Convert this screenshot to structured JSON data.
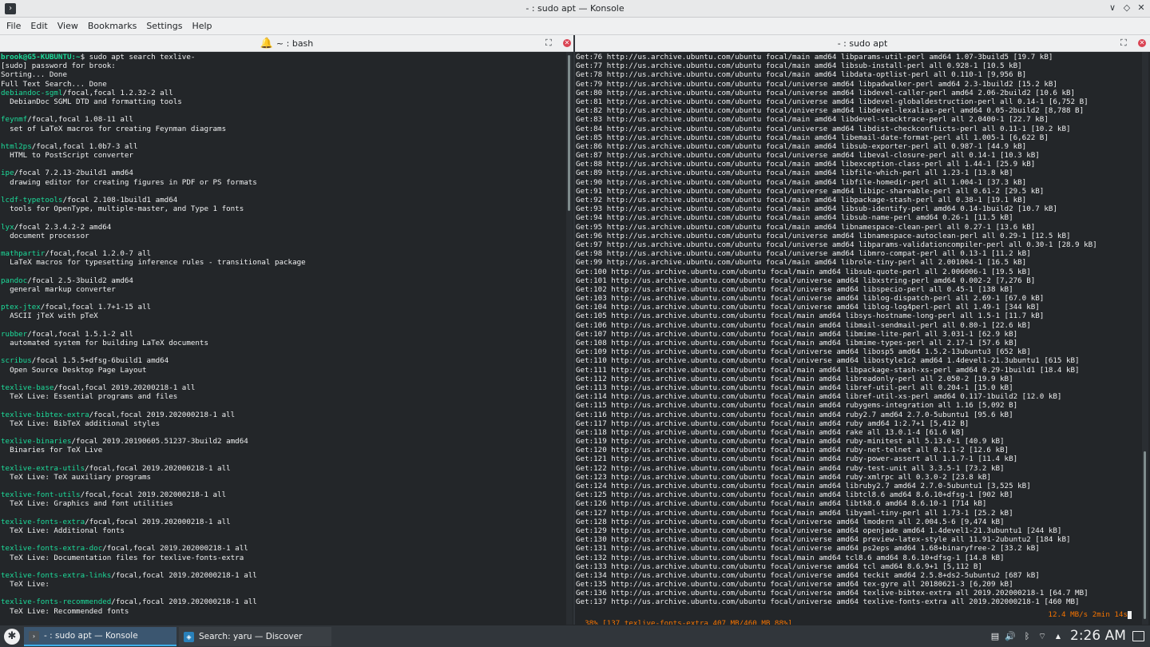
{
  "window": {
    "title": "- : sudo apt — Konsole",
    "app_icon_glyph": "›",
    "controls": [
      "∨",
      "◇",
      "✕"
    ]
  },
  "menu": [
    "File",
    "Edit",
    "View",
    "Bookmarks",
    "Settings",
    "Help"
  ],
  "panes": {
    "left": {
      "title": "~ : bash",
      "bell_icon": "bell-icon"
    },
    "right": {
      "title": "- : sudo apt"
    }
  },
  "left_terminal": [
    [
      {
        "t": "brook@G5-KUBUNTU:~",
        "c": "prompt-user"
      },
      {
        "t": "$ sudo apt search texlive-"
      }
    ],
    [
      {
        "t": "[sudo] password for brook:"
      }
    ],
    [
      {
        "t": "Sorting... Done"
      }
    ],
    [
      {
        "t": "Full Text Search... Done"
      }
    ],
    [
      {
        "t": "debiandoc-sgml",
        "c": "green"
      },
      {
        "t": "/focal,focal 1.2.32-2 all"
      }
    ],
    [
      {
        "t": "  DebianDoc SGML DTD and formatting tools"
      }
    ],
    [
      {
        "t": ""
      }
    ],
    [
      {
        "t": "feynmf",
        "c": "green"
      },
      {
        "t": "/focal,focal 1.08-11 all"
      }
    ],
    [
      {
        "t": "  set of LaTeX macros for creating Feynman diagrams"
      }
    ],
    [
      {
        "t": ""
      }
    ],
    [
      {
        "t": "html2ps",
        "c": "green"
      },
      {
        "t": "/focal,focal 1.0b7-3 all"
      }
    ],
    [
      {
        "t": "  HTML to PostScript converter"
      }
    ],
    [
      {
        "t": ""
      }
    ],
    [
      {
        "t": "ipe",
        "c": "green"
      },
      {
        "t": "/focal 7.2.13-2build1 amd64"
      }
    ],
    [
      {
        "t": "  drawing editor for creating figures in PDF or PS formats"
      }
    ],
    [
      {
        "t": ""
      }
    ],
    [
      {
        "t": "lcdf-typetools",
        "c": "green"
      },
      {
        "t": "/focal 2.108-1build1 amd64"
      }
    ],
    [
      {
        "t": "  tools for OpenType, multiple-master, and Type 1 fonts"
      }
    ],
    [
      {
        "t": ""
      }
    ],
    [
      {
        "t": "lyx",
        "c": "green"
      },
      {
        "t": "/focal 2.3.4.2-2 amd64"
      }
    ],
    [
      {
        "t": "  document processor"
      }
    ],
    [
      {
        "t": ""
      }
    ],
    [
      {
        "t": "mathpartir",
        "c": "green"
      },
      {
        "t": "/focal,focal 1.2.0-7 all"
      }
    ],
    [
      {
        "t": "  LaTeX macros for typesetting inference rules - transitional package"
      }
    ],
    [
      {
        "t": ""
      }
    ],
    [
      {
        "t": "pandoc",
        "c": "green"
      },
      {
        "t": "/focal 2.5-3build2 amd64"
      }
    ],
    [
      {
        "t": "  general markup converter"
      }
    ],
    [
      {
        "t": ""
      }
    ],
    [
      {
        "t": "ptex-jtex",
        "c": "green"
      },
      {
        "t": "/focal,focal 1.7+1-15 all"
      }
    ],
    [
      {
        "t": "  ASCII jTeX with pTeX"
      }
    ],
    [
      {
        "t": ""
      }
    ],
    [
      {
        "t": "rubber",
        "c": "green"
      },
      {
        "t": "/focal,focal 1.5.1-2 all"
      }
    ],
    [
      {
        "t": "  automated system for building LaTeX documents"
      }
    ],
    [
      {
        "t": ""
      }
    ],
    [
      {
        "t": "scribus",
        "c": "green"
      },
      {
        "t": "/focal 1.5.5+dfsg-6build1 amd64"
      }
    ],
    [
      {
        "t": "  Open Source Desktop Page Layout"
      }
    ],
    [
      {
        "t": ""
      }
    ],
    [
      {
        "t": "texlive-base",
        "c": "green"
      },
      {
        "t": "/focal,focal 2019.20200218-1 all"
      }
    ],
    [
      {
        "t": "  TeX Live: Essential programs and files"
      }
    ],
    [
      {
        "t": ""
      }
    ],
    [
      {
        "t": "texlive-bibtex-extra",
        "c": "green"
      },
      {
        "t": "/focal,focal 2019.202000218-1 all"
      }
    ],
    [
      {
        "t": "  TeX Live: BibTeX additional styles"
      }
    ],
    [
      {
        "t": ""
      }
    ],
    [
      {
        "t": "texlive-binaries",
        "c": "green"
      },
      {
        "t": "/focal 2019.20190605.51237-3build2 amd64"
      }
    ],
    [
      {
        "t": "  Binaries for TeX Live"
      }
    ],
    [
      {
        "t": ""
      }
    ],
    [
      {
        "t": "texlive-extra-utils",
        "c": "green"
      },
      {
        "t": "/focal,focal 2019.202000218-1 all"
      }
    ],
    [
      {
        "t": "  TeX Live: TeX auxiliary programs"
      }
    ],
    [
      {
        "t": ""
      }
    ],
    [
      {
        "t": "texlive-font-utils",
        "c": "green"
      },
      {
        "t": "/focal,focal 2019.202000218-1 all"
      }
    ],
    [
      {
        "t": "  TeX Live: Graphics and font utilities"
      }
    ],
    [
      {
        "t": ""
      }
    ],
    [
      {
        "t": "texlive-fonts-extra",
        "c": "green"
      },
      {
        "t": "/focal,focal 2019.202000218-1 all"
      }
    ],
    [
      {
        "t": "  TeX Live: Additional fonts"
      }
    ],
    [
      {
        "t": ""
      }
    ],
    [
      {
        "t": "texlive-fonts-extra-doc",
        "c": "green"
      },
      {
        "t": "/focal,focal 2019.202000218-1 all"
      }
    ],
    [
      {
        "t": "  TeX Live: Documentation files for texlive-fonts-extra"
      }
    ],
    [
      {
        "t": ""
      }
    ],
    [
      {
        "t": "texlive-fonts-extra-links",
        "c": "green"
      },
      {
        "t": "/focal,focal 2019.202000218-1 all"
      }
    ],
    [
      {
        "t": "  TeX Live:"
      }
    ],
    [
      {
        "t": ""
      }
    ],
    [
      {
        "t": "texlive-fonts-recommended",
        "c": "green"
      },
      {
        "t": "/focal,focal 2019.202000218-1 all"
      }
    ],
    [
      {
        "t": "  TeX Live: Recommended fonts"
      }
    ]
  ],
  "right_terminal": [
    "Get:76 http://us.archive.ubuntu.com/ubuntu focal/main amd64 libparams-util-perl amd64 1.07-3build5 [19.7 kB]",
    "Get:77 http://us.archive.ubuntu.com/ubuntu focal/main amd64 libsub-install-perl all 0.928-1 [10.5 kB]",
    "Get:78 http://us.archive.ubuntu.com/ubuntu focal/main amd64 libdata-optlist-perl all 0.110-1 [9,956 B]",
    "Get:79 http://us.archive.ubuntu.com/ubuntu focal/universe amd64 libpadwalker-perl amd64 2.3-1build2 [15.2 kB]",
    "Get:80 http://us.archive.ubuntu.com/ubuntu focal/universe amd64 libdevel-caller-perl amd64 2.06-2build2 [10.6 kB]",
    "Get:81 http://us.archive.ubuntu.com/ubuntu focal/universe amd64 libdevel-globaldestruction-perl all 0.14-1 [6,752 B]",
    "Get:82 http://us.archive.ubuntu.com/ubuntu focal/universe amd64 libdevel-lexalias-perl amd64 0.05-2build2 [8,788 B]",
    "Get:83 http://us.archive.ubuntu.com/ubuntu focal/main amd64 libdevel-stacktrace-perl all 2.0400-1 [22.7 kB]",
    "Get:84 http://us.archive.ubuntu.com/ubuntu focal/universe amd64 libdist-checkconflicts-perl all 0.11-1 [10.2 kB]",
    "Get:85 http://us.archive.ubuntu.com/ubuntu focal/main amd64 libemail-date-format-perl all 1.005-1 [6,622 B]",
    "Get:86 http://us.archive.ubuntu.com/ubuntu focal/main amd64 libsub-exporter-perl all 0.987-1 [44.9 kB]",
    "Get:87 http://us.archive.ubuntu.com/ubuntu focal/universe amd64 libeval-closure-perl all 0.14-1 [10.3 kB]",
    "Get:88 http://us.archive.ubuntu.com/ubuntu focal/main amd64 libexception-class-perl all 1.44-1 [25.9 kB]",
    "Get:89 http://us.archive.ubuntu.com/ubuntu focal/main amd64 libfile-which-perl all 1.23-1 [13.8 kB]",
    "Get:90 http://us.archive.ubuntu.com/ubuntu focal/main amd64 libfile-homedir-perl all 1.004-1 [37.3 kB]",
    "Get:91 http://us.archive.ubuntu.com/ubuntu focal/universe amd64 libipc-shareable-perl all 0.61-2 [29.5 kB]",
    "Get:92 http://us.archive.ubuntu.com/ubuntu focal/main amd64 libpackage-stash-perl all 0.38-1 [19.1 kB]",
    "Get:93 http://us.archive.ubuntu.com/ubuntu focal/main amd64 libsub-identify-perl amd64 0.14-1build2 [10.7 kB]",
    "Get:94 http://us.archive.ubuntu.com/ubuntu focal/main amd64 libsub-name-perl amd64 0.26-1 [11.5 kB]",
    "Get:95 http://us.archive.ubuntu.com/ubuntu focal/main amd64 libnamespace-clean-perl all 0.27-1 [13.6 kB]",
    "Get:96 http://us.archive.ubuntu.com/ubuntu focal/universe amd64 libnamespace-autoclean-perl all 0.29-1 [12.5 kB]",
    "Get:97 http://us.archive.ubuntu.com/ubuntu focal/universe amd64 libparams-validationcompiler-perl all 0.30-1 [28.9 kB]",
    "Get:98 http://us.archive.ubuntu.com/ubuntu focal/universe amd64 libmro-compat-perl all 0.13-1 [11.2 kB]",
    "Get:99 http://us.archive.ubuntu.com/ubuntu focal/main amd64 librole-tiny-perl all 2.001004-1 [16.5 kB]",
    "Get:100 http://us.archive.ubuntu.com/ubuntu focal/main amd64 libsub-quote-perl all 2.006006-1 [19.5 kB]",
    "Get:101 http://us.archive.ubuntu.com/ubuntu focal/universe amd64 libxstring-perl amd64 0.002-2 [7,276 B]",
    "Get:102 http://us.archive.ubuntu.com/ubuntu focal/universe amd64 libspecio-perl all 0.45-1 [138 kB]",
    "Get:103 http://us.archive.ubuntu.com/ubuntu focal/universe amd64 liblog-dispatch-perl all 2.69-1 [67.0 kB]",
    "Get:104 http://us.archive.ubuntu.com/ubuntu focal/universe amd64 liblog-log4perl-perl all 1.49-1 [344 kB]",
    "Get:105 http://us.archive.ubuntu.com/ubuntu focal/main amd64 libsys-hostname-long-perl all 1.5-1 [11.7 kB]",
    "Get:106 http://us.archive.ubuntu.com/ubuntu focal/main amd64 libmail-sendmail-perl all 0.80-1 [22.6 kB]",
    "Get:107 http://us.archive.ubuntu.com/ubuntu focal/main amd64 libmime-lite-perl all 3.031-1 [62.9 kB]",
    "Get:108 http://us.archive.ubuntu.com/ubuntu focal/main amd64 libmime-types-perl all 2.17-1 [57.6 kB]",
    "Get:109 http://us.archive.ubuntu.com/ubuntu focal/universe amd64 libosp5 amd64 1.5.2-13ubuntu3 [652 kB]",
    "Get:110 http://us.archive.ubuntu.com/ubuntu focal/universe amd64 libostyle1c2 amd64 1.4devel1-21.3ubuntu1 [615 kB]",
    "Get:111 http://us.archive.ubuntu.com/ubuntu focal/main amd64 libpackage-stash-xs-perl amd64 0.29-1build1 [18.4 kB]",
    "Get:112 http://us.archive.ubuntu.com/ubuntu focal/main amd64 libreadonly-perl all 2.050-2 [19.9 kB]",
    "Get:113 http://us.archive.ubuntu.com/ubuntu focal/main amd64 libref-util-perl all 0.204-1 [15.0 kB]",
    "Get:114 http://us.archive.ubuntu.com/ubuntu focal/main amd64 libref-util-xs-perl amd64 0.117-1build2 [12.0 kB]",
    "Get:115 http://us.archive.ubuntu.com/ubuntu focal/main amd64 rubygems-integration all 1.16 [5,092 B]",
    "Get:116 http://us.archive.ubuntu.com/ubuntu focal/main amd64 ruby2.7 amd64 2.7.0-5ubuntu1 [95.6 kB]",
    "Get:117 http://us.archive.ubuntu.com/ubuntu focal/main amd64 ruby amd64 1:2.7+1 [5,412 B]",
    "Get:118 http://us.archive.ubuntu.com/ubuntu focal/main amd64 rake all 13.0.1-4 [61.6 kB]",
    "Get:119 http://us.archive.ubuntu.com/ubuntu focal/main amd64 ruby-minitest all 5.13.0-1 [40.9 kB]",
    "Get:120 http://us.archive.ubuntu.com/ubuntu focal/main amd64 ruby-net-telnet all 0.1.1-2 [12.6 kB]",
    "Get:121 http://us.archive.ubuntu.com/ubuntu focal/main amd64 ruby-power-assert all 1.1.7-1 [11.4 kB]",
    "Get:122 http://us.archive.ubuntu.com/ubuntu focal/main amd64 ruby-test-unit all 3.3.5-1 [73.2 kB]",
    "Get:123 http://us.archive.ubuntu.com/ubuntu focal/main amd64 ruby-xmlrpc all 0.3.0-2 [23.8 kB]",
    "Get:124 http://us.archive.ubuntu.com/ubuntu focal/main amd64 libruby2.7 amd64 2.7.0-5ubuntu1 [3,525 kB]",
    "Get:125 http://us.archive.ubuntu.com/ubuntu focal/main amd64 libtcl8.6 amd64 8.6.10+dfsg-1 [902 kB]",
    "Get:126 http://us.archive.ubuntu.com/ubuntu focal/main amd64 libtk8.6 amd64 8.6.10-1 [714 kB]",
    "Get:127 http://us.archive.ubuntu.com/ubuntu focal/main amd64 libyaml-tiny-perl all 1.73-1 [25.2 kB]",
    "Get:128 http://us.archive.ubuntu.com/ubuntu focal/universe amd64 lmodern all 2.004.5-6 [9,474 kB]",
    "Get:129 http://us.archive.ubuntu.com/ubuntu focal/universe amd64 openjade amd64 1.4devel1-21.3ubuntu1 [244 kB]",
    "Get:130 http://us.archive.ubuntu.com/ubuntu focal/universe amd64 preview-latex-style all 11.91-2ubuntu2 [184 kB]",
    "Get:131 http://us.archive.ubuntu.com/ubuntu focal/universe amd64 ps2eps amd64 1.68+binaryfree-2 [33.2 kB]",
    "Get:132 http://us.archive.ubuntu.com/ubuntu focal/main amd64 tcl8.6 amd64 8.6.10+dfsg-1 [14.8 kB]",
    "Get:133 http://us.archive.ubuntu.com/ubuntu focal/universe amd64 tcl amd64 8.6.9+1 [5,112 B]",
    "Get:134 http://us.archive.ubuntu.com/ubuntu focal/universe amd64 teckit amd64 2.5.8+ds2-5ubuntu2 [687 kB]",
    "Get:135 http://us.archive.ubuntu.com/ubuntu focal/universe amd64 tex-gyre all 20180621-3 [6,209 kB]",
    "Get:136 http://us.archive.ubuntu.com/ubuntu focal/universe amd64 texlive-bibtex-extra all 2019.202000218-1 [64.7 MB]",
    "Get:137 http://us.archive.ubuntu.com/ubuntu focal/universe amd64 texlive-fonts-extra all 2019.202000218-1 [460 MB]"
  ],
  "status_bar": {
    "left": "38% [137 texlive-fonts-extra 407 MB/460 MB 88%]",
    "right": "12.4 MB/s 2min 14s"
  },
  "taskbar": {
    "launcher_icon": "kubuntu-logo-icon",
    "tasks": [
      {
        "label": "- : sudo apt — Konsole",
        "icon": "konsole-icon",
        "active": true
      },
      {
        "label": "Search: yaru — Discover",
        "icon": "discover-icon",
        "active": false
      }
    ],
    "tray": [
      {
        "name": "clipboard-icon",
        "glyph": "▤"
      },
      {
        "name": "volume-icon",
        "glyph": "🔊"
      },
      {
        "name": "bluetooth-icon",
        "glyph": "ᛒ"
      },
      {
        "name": "network-icon",
        "glyph": "⌔"
      },
      {
        "name": "tray-expand-icon",
        "glyph": "▲"
      }
    ],
    "clock": "2:26 AM"
  }
}
